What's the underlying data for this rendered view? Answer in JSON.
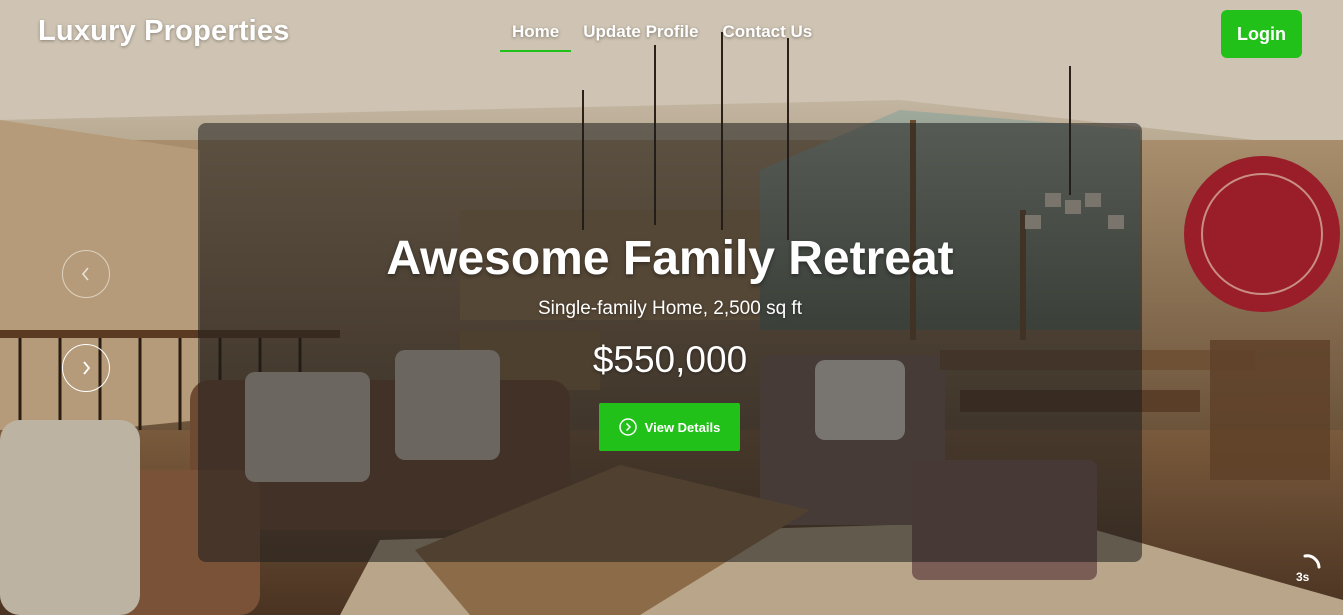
{
  "header": {
    "logo": "Luxury Properties",
    "nav": [
      {
        "label": "Home",
        "active": true
      },
      {
        "label": "Update Profile",
        "active": false
      },
      {
        "label": "Contact Us",
        "active": false
      }
    ],
    "login_label": "Login"
  },
  "slide": {
    "title": "Awesome Family Retreat",
    "subtitle": "Single-family Home, 2,500 sq ft",
    "price": "$550,000",
    "cta_label": "View Details"
  },
  "carousel": {
    "prev_icon": "chevron-left-icon",
    "next_icon": "chevron-right-icon",
    "timer_label": "3s"
  },
  "colors": {
    "accent": "#22c11a",
    "overlay": "rgba(30,30,30,0.55)",
    "text": "#ffffff"
  }
}
